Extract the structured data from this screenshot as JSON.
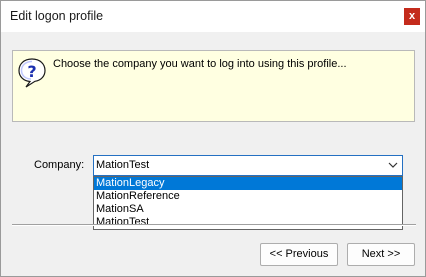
{
  "window": {
    "title": "Edit logon profile",
    "close_label": "x"
  },
  "info": {
    "icon": "question-help-icon",
    "text": "Choose the company you want to log into using this profile..."
  },
  "company": {
    "label": "Company:",
    "selected_value": "MationTest",
    "options": [
      {
        "label": "MationLegacy",
        "highlighted": true
      },
      {
        "label": "MationReference",
        "highlighted": false
      },
      {
        "label": "MationSA",
        "highlighted": false
      },
      {
        "label": "MationTest",
        "highlighted": false
      }
    ]
  },
  "buttons": {
    "previous_label": "<< Previous",
    "next_label": "Next >>"
  },
  "colors": {
    "close_bg": "#c42b1c",
    "info_bg": "#ffffe1",
    "selection": "#0078d7",
    "focus_border": "#2470c2"
  }
}
